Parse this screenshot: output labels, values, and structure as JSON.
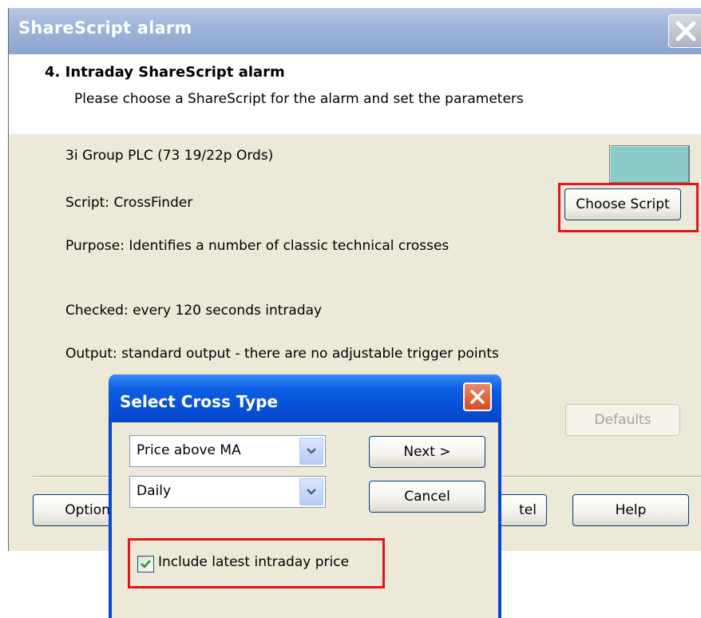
{
  "main_dialog": {
    "title": "ShareScript alarm",
    "header_title": "4. Intraday ShareScript alarm",
    "header_subtitle": "Please choose a ShareScript for the alarm and set the parameters",
    "stock_name": "3i Group PLC (73 19/22p Ords)",
    "script_line": "Script:  CrossFinder",
    "purpose_line": "Purpose: Identifies a number of classic technical crosses",
    "checked_line": "Checked: every 120 seconds intraday",
    "output_line": "Output: standard output - there are no adjustable trigger points",
    "alarm_color": "#8dcbc6",
    "choose_script_label": "Choose Script",
    "defaults_label": "Defaults",
    "options_label": "Options",
    "cancel_label_partial": "tel",
    "help_label": "Help"
  },
  "cross_dialog": {
    "title": "Select Cross Type",
    "cross_type_value": "Price above MA",
    "period_value": "Daily",
    "next_label": "Next >",
    "cancel_label": "Cancel",
    "include_intraday_label": "Include latest intraday price",
    "include_intraday_checked": true
  },
  "colors": {
    "highlight": "#e3151c",
    "xp_blue": "#0650d8",
    "dialog_face": "#ece9d8"
  }
}
